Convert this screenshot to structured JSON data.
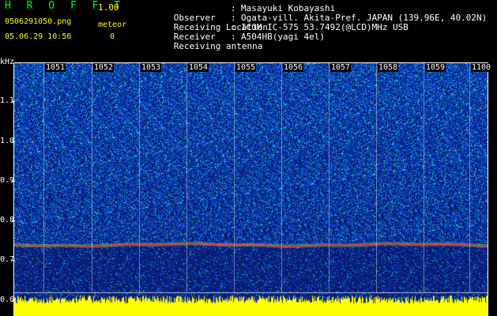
{
  "app": {
    "name": "H R O F F T",
    "version": "1.00",
    "filename": "0506291050.png",
    "timestamp": "05.06.29 10:50",
    "meteor_label": "meteor",
    "meteor_count": "0"
  },
  "info": {
    "rows": [
      {
        "label": "Observer",
        "sep": ":",
        "value": "Masayuki Kobayashi"
      },
      {
        "label": "Receiving Location",
        "sep": ":",
        "value": "Ogata-vill. Akita-Pref. JAPAN (139.96E, 40.02N)"
      },
      {
        "label": "Receiver",
        "sep": ":",
        "value": "ICOM IC-575 53.7492(@LCD)MHz USB"
      },
      {
        "label": "Receiving antenna",
        "sep": ":",
        "value": "A504HB(yagi 4el)"
      }
    ]
  },
  "axis": {
    "unit": "kHz",
    "yticks": [
      "1.1",
      "1.0",
      "0.9",
      "0.8",
      "0.7",
      "0.6"
    ],
    "minutes": [
      "1051",
      "1052",
      "1053",
      "1054",
      "1055",
      "1056",
      "1057",
      "1058",
      "1059",
      "1100"
    ]
  },
  "colors": {
    "background": "#000000",
    "spectrogram_base": "#0a1560",
    "carrier": "#ff3030",
    "noise_bar": "#ffff00",
    "title_green": "#00ff00",
    "title_yellow": "#ffff00"
  }
}
